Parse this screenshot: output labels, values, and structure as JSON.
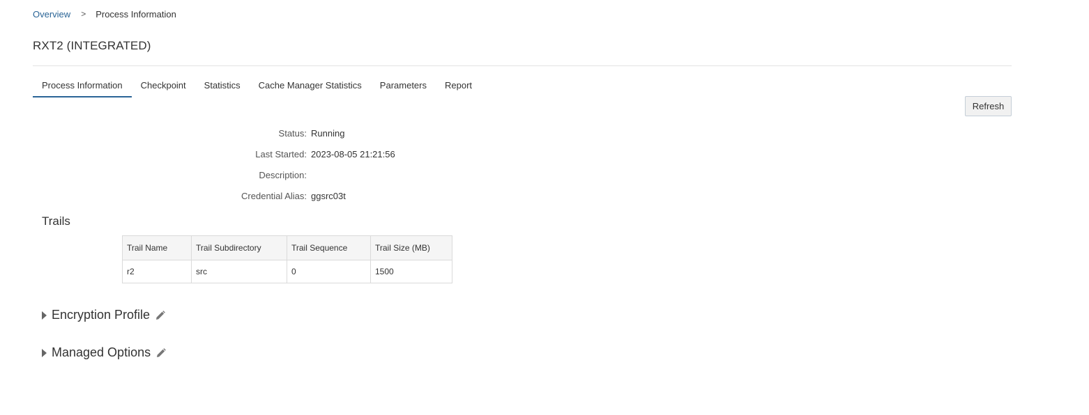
{
  "breadcrumb": {
    "root": "Overview",
    "separator": ">",
    "current": "Process Information"
  },
  "page": {
    "title": "RXT2 (INTEGRATED)"
  },
  "tabs": [
    {
      "label": "Process Information",
      "active": true
    },
    {
      "label": "Checkpoint",
      "active": false
    },
    {
      "label": "Statistics",
      "active": false
    },
    {
      "label": "Cache Manager Statistics",
      "active": false
    },
    {
      "label": "Parameters",
      "active": false
    },
    {
      "label": "Report",
      "active": false
    }
  ],
  "toolbar": {
    "refresh_label": "Refresh"
  },
  "info": {
    "status": {
      "label": "Status:",
      "value": "Running"
    },
    "last_started": {
      "label": "Last Started:",
      "value": "2023-08-05 21:21:56"
    },
    "description": {
      "label": "Description:",
      "value": ""
    },
    "credential_alias": {
      "label": "Credential Alias:",
      "value": "ggsrc03t"
    }
  },
  "trails": {
    "heading": "Trails",
    "columns": [
      "Trail Name",
      "Trail Subdirectory",
      "Trail Sequence",
      "Trail Size (MB)"
    ],
    "rows": [
      [
        "r2",
        "src",
        "0",
        "1500"
      ]
    ]
  },
  "sections": {
    "encryption_profile": "Encryption Profile",
    "managed_options": "Managed Options"
  },
  "colors": {
    "link": "#2a6496",
    "tab_underline": "#2a6496",
    "text": "#333333"
  }
}
